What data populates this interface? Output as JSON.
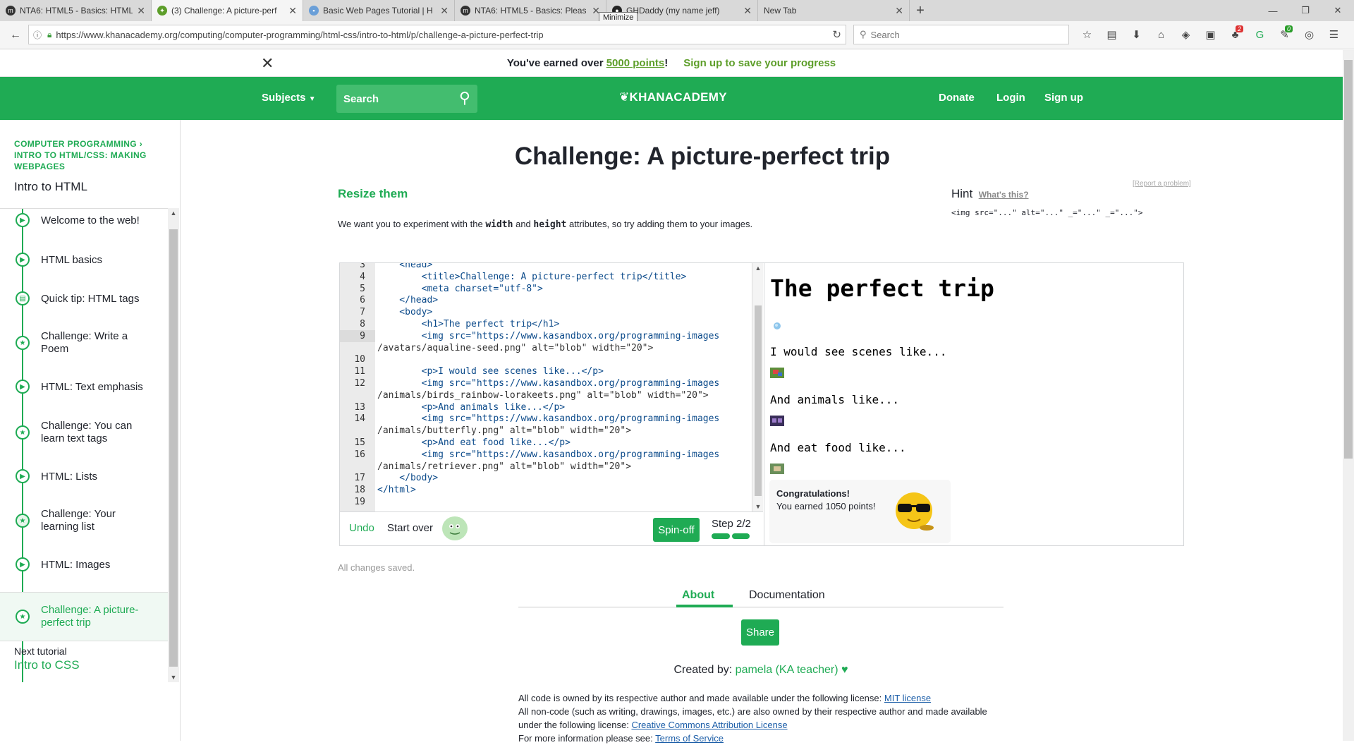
{
  "browser": {
    "tabs": [
      {
        "label": "NTA6: HTML5 - Basics: HTML",
        "favicon": "mastodon-m",
        "active": false
      },
      {
        "label": "(3) Challenge: A picture-perf",
        "favicon": "ka-leaf",
        "active": true
      },
      {
        "label": "Basic Web Pages Tutorial | H",
        "favicon": "page",
        "active": false
      },
      {
        "label": "NTA6: HTML5 - Basics: Pleas",
        "favicon": "mastodon-m",
        "active": false
      },
      {
        "label": "GHDaddy (my name jeff)",
        "favicon": "github",
        "active": false
      },
      {
        "label": "New Tab",
        "favicon": "",
        "active": false
      }
    ],
    "tooltip": "Minimize",
    "url": "https://www.khanacademy.org/computing/computer-programming/html-css/intro-to-html/p/challenge-a-picture-perfect-trip",
    "search_placeholder": "Search",
    "badges": {
      "red": "2",
      "green": "0"
    }
  },
  "promo": {
    "text_before": "You've earned over",
    "points_link": "5000 points",
    "text_after": "!",
    "signup": "Sign up to save your progress"
  },
  "header": {
    "subjects": "Subjects",
    "search_placeholder": "Search",
    "logo": "KHANACADEMY",
    "donate": "Donate",
    "login": "Login",
    "signup": "Sign up"
  },
  "sidebar": {
    "breadcrumb_1": "COMPUTER PROGRAMMING",
    "breadcrumb_2": "INTRO TO HTML/CSS: MAKING WEBPAGES",
    "title": "Intro to HTML",
    "lessons": [
      {
        "label": "Welcome to the web!",
        "icon": "play-icon"
      },
      {
        "label": "HTML basics",
        "icon": "play-icon"
      },
      {
        "label": "Quick tip: HTML tags",
        "icon": "article-icon"
      },
      {
        "label": "Challenge: Write a Poem",
        "icon": "star-icon"
      },
      {
        "label": "HTML: Text emphasis",
        "icon": "play-icon"
      },
      {
        "label": "Challenge: You can learn text tags",
        "icon": "star-icon"
      },
      {
        "label": "HTML: Lists",
        "icon": "play-icon"
      },
      {
        "label": "Challenge: Your learning list",
        "icon": "star-icon"
      },
      {
        "label": "HTML: Images",
        "icon": "play-icon"
      },
      {
        "label": "Challenge: A picture-perfect trip",
        "icon": "star-icon"
      }
    ],
    "next_label": "Next tutorial",
    "next_title": "Intro to CSS"
  },
  "main": {
    "title": "Challenge: A picture-perfect trip",
    "subheading": "Resize them",
    "instruction_1": "We want you to experiment with the",
    "instruction_code_1": "width",
    "instruction_2": "and",
    "instruction_code_2": "height",
    "instruction_3": "attributes, so try adding them to your images.",
    "hint_title": "Hint",
    "hint_link": "What's this?",
    "hint_code": "<img src=\"...\" alt=\"...\" _=\"...\" _=\"...\">",
    "report": "[Report a problem]"
  },
  "code": {
    "lines": [
      {
        "n": "3",
        "t": "    <head>"
      },
      {
        "n": "4",
        "t": "        <title>Challenge: A picture-perfect trip</title>"
      },
      {
        "n": "5",
        "t": "        <meta charset=\"utf-8\">"
      },
      {
        "n": "6",
        "t": "    </head>"
      },
      {
        "n": "7",
        "t": "    <body>"
      },
      {
        "n": "8",
        "t": "        <h1>The perfect trip</h1>"
      },
      {
        "n": "9",
        "t": "        <img src=\"https://www.kasandbox.org/programming-images"
      },
      {
        "n": "",
        "t": "/avatars/aqualine-seed.png\" alt=\"blob\" width=\"20\">"
      },
      {
        "n": "10",
        "t": ""
      },
      {
        "n": "11",
        "t": "        <p>I would see scenes like...</p>"
      },
      {
        "n": "12",
        "t": "        <img src=\"https://www.kasandbox.org/programming-images"
      },
      {
        "n": "",
        "t": "/animals/birds_rainbow-lorakeets.png\" alt=\"blob\" width=\"20\">"
      },
      {
        "n": "13",
        "t": "        <p>And animals like...</p>"
      },
      {
        "n": "14",
        "t": "        <img src=\"https://www.kasandbox.org/programming-images"
      },
      {
        "n": "",
        "t": "/animals/butterfly.png\" alt=\"blob\" width=\"20\">"
      },
      {
        "n": "15",
        "t": "        <p>And eat food like...</p>"
      },
      {
        "n": "16",
        "t": "        <img src=\"https://www.kasandbox.org/programming-images"
      },
      {
        "n": "",
        "t": "/animals/retriever.png\" alt=\"blob\" width=\"20\">"
      },
      {
        "n": "17",
        "t": "    </body>"
      },
      {
        "n": "18",
        "t": "</html>"
      },
      {
        "n": "19",
        "t": ""
      }
    ],
    "undo": "Undo",
    "start_over": "Start over",
    "spinoff": "Spin-off",
    "step": "Step 2/2"
  },
  "preview": {
    "h1": "The perfect trip",
    "p1": "I would see scenes like...",
    "p2": "And animals like...",
    "p3": "And eat food like...",
    "congrats_title": "Congratulations!",
    "congrats_text": "You earned 1050 points!"
  },
  "footer": {
    "saved": "All changes saved.",
    "tab_about": "About",
    "tab_docs": "Documentation",
    "share": "Share",
    "created_by": "Created by:",
    "author": "pamela (KA teacher)",
    "license_1": "All code is owned by its respective author and made available under the following license:",
    "license_1_link": "MIT license",
    "license_2": "All non-code (such as writing, drawings, images, etc.) are also owned by their respective author and made available under the following license:",
    "license_2_link": "Creative Commons Attribution License",
    "license_3": "For more information please see:",
    "license_3_link": "Terms of Service"
  },
  "colors": {
    "brand_green": "#1fab54",
    "promo_green": "#5d9e2a"
  }
}
